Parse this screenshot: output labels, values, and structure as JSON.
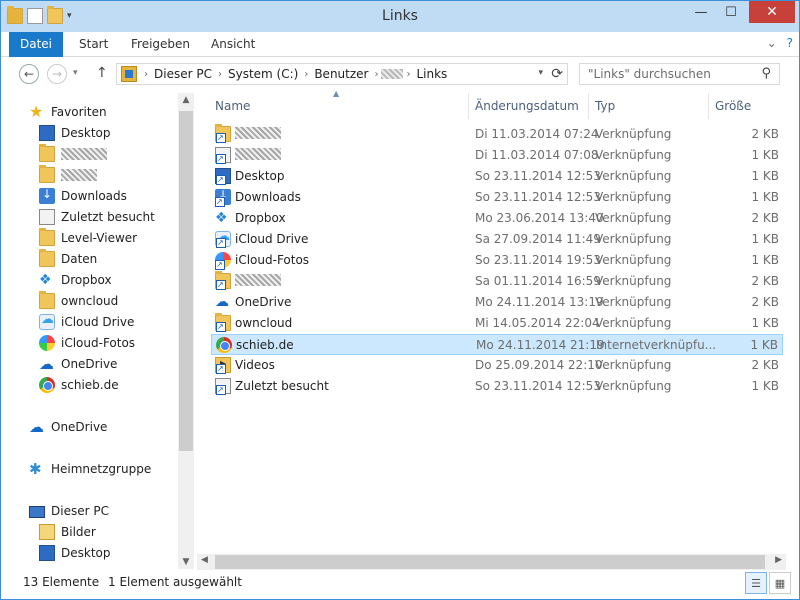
{
  "window": {
    "title": "Links"
  },
  "ribbon": {
    "tabs": [
      "Datei",
      "Start",
      "Freigeben",
      "Ansicht"
    ]
  },
  "address": {
    "crumbs": [
      "Dieser PC",
      "System (C:)",
      "Benutzer",
      "Links"
    ],
    "search_placeholder": "\"Links\" durchsuchen"
  },
  "nav": {
    "favorites_label": "Favoriten",
    "favorites": [
      "Desktop",
      "",
      "",
      "Downloads",
      "Zuletzt besucht",
      "Level-Viewer",
      "Daten",
      "Dropbox",
      "owncloud",
      "iCloud Drive",
      "iCloud-Fotos",
      "OneDrive",
      "schieb.de"
    ],
    "onedrive": "OneDrive",
    "homegroup": "Heimnetzgruppe",
    "thispc": "Dieser PC",
    "pc_items": [
      "Bilder",
      "Desktop"
    ]
  },
  "columns": {
    "name": "Name",
    "date": "Änderungsdatum",
    "type": "Typ",
    "size": "Größe"
  },
  "files": [
    {
      "name": "",
      "date": "Di 11.03.2014 07:24",
      "type": "Verknüpfung",
      "size": "2 KB",
      "icon": "folder-shortcut"
    },
    {
      "name": "",
      "date": "Di 11.03.2014 07:08",
      "type": "Verknüpfung",
      "size": "1 KB",
      "icon": "shortcut"
    },
    {
      "name": "Desktop",
      "date": "So 23.11.2014 12:53",
      "type": "Verknüpfung",
      "size": "1 KB",
      "icon": "desktop"
    },
    {
      "name": "Downloads",
      "date": "So 23.11.2014 12:53",
      "type": "Verknüpfung",
      "size": "1 KB",
      "icon": "downloads"
    },
    {
      "name": "Dropbox",
      "date": "Mo 23.06.2014 13:40",
      "type": "Verknüpfung",
      "size": "2 KB",
      "icon": "dropbox"
    },
    {
      "name": "iCloud Drive",
      "date": "Sa 27.09.2014 11:49",
      "type": "Verknüpfung",
      "size": "1 KB",
      "icon": "icloud"
    },
    {
      "name": "iCloud-Fotos",
      "date": "So 23.11.2014 19:53",
      "type": "Verknüpfung",
      "size": "1 KB",
      "icon": "photos"
    },
    {
      "name": "",
      "date": "Sa 01.11.2014 16:59",
      "type": "Verknüpfung",
      "size": "2 KB",
      "icon": "folder-shortcut"
    },
    {
      "name": "OneDrive",
      "date": "Mo 24.11.2014 13:19",
      "type": "Verknüpfung",
      "size": "2 KB",
      "icon": "onedrive"
    },
    {
      "name": "owncloud",
      "date": "Mi 14.05.2014 22:04",
      "type": "Verknüpfung",
      "size": "1 KB",
      "icon": "folder-shortcut"
    },
    {
      "name": "schieb.de",
      "date": "Mo 24.11.2014 21:19",
      "type": "Internetverknüpfu...",
      "size": "1 KB",
      "icon": "chrome",
      "selected": true
    },
    {
      "name": "Videos",
      "date": "Do 25.09.2014 22:10",
      "type": "Verknüpfung",
      "size": "2 KB",
      "icon": "videos"
    },
    {
      "name": "Zuletzt besucht",
      "date": "So 23.11.2014 12:53",
      "type": "Verknüpfung",
      "size": "1 KB",
      "icon": "recent"
    }
  ],
  "status": {
    "count": "13 Elemente",
    "selection": "1 Element ausgewählt"
  },
  "colors": {
    "accent": "#1979ca",
    "selection": "#cce8ff",
    "close": "#c7403a"
  }
}
